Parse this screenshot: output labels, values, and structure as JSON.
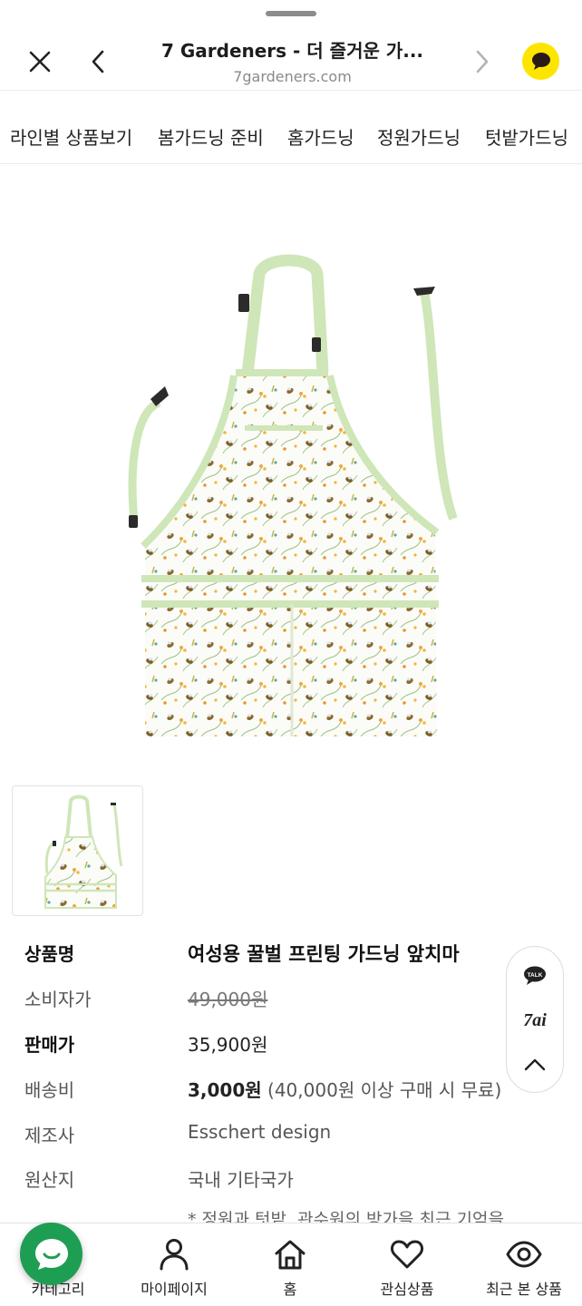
{
  "browser": {
    "title": "7 Gardeners - 더 즐거운 가...",
    "url": "7gardeners.com",
    "close_icon": "close-icon",
    "back_icon": "chevron-left-icon",
    "forward_icon": "chevron-right-icon",
    "kakao_icon": "kakao-chat-icon",
    "accent": "#fee500"
  },
  "category_nav": [
    "라인별 상품보기",
    "봄가드닝 준비",
    "홈가드닝",
    "정원가드닝",
    "텃밭가드닝"
  ],
  "product": {
    "rows": [
      {
        "label": "상품명",
        "value": "여성용 꿀벌 프린팅 가드닝 앞치마"
      },
      {
        "label": "소비자가",
        "value": "49,000원"
      },
      {
        "label": "판매가",
        "value": "35,900원"
      },
      {
        "label": "배송비",
        "value": "3,000원",
        "extra": " (40,000원 이상 구매 시 무료)"
      },
      {
        "label": "제조사",
        "value": "Esschert design"
      },
      {
        "label": "원산지",
        "value": "국내 기타국가"
      }
    ],
    "notice": "* 정원과 텃밭, 관수원의 방가을 최근 기억을"
  },
  "floating_menu": {
    "talk_label": "TALK",
    "ai_label": "7ai",
    "top_icon": "chevron-up-icon"
  },
  "bottom_nav": [
    {
      "label": "카테고리",
      "icon": "category-icon"
    },
    {
      "label": "마이페이지",
      "icon": "person-icon"
    },
    {
      "label": "홈",
      "icon": "home-icon"
    },
    {
      "label": "관심상품",
      "icon": "heart-icon"
    },
    {
      "label": "최근 본 상품",
      "icon": "eye-icon"
    }
  ],
  "colors": {
    "apron_trim": "#cfe6b8",
    "chat_fab": "#1e9e53"
  }
}
